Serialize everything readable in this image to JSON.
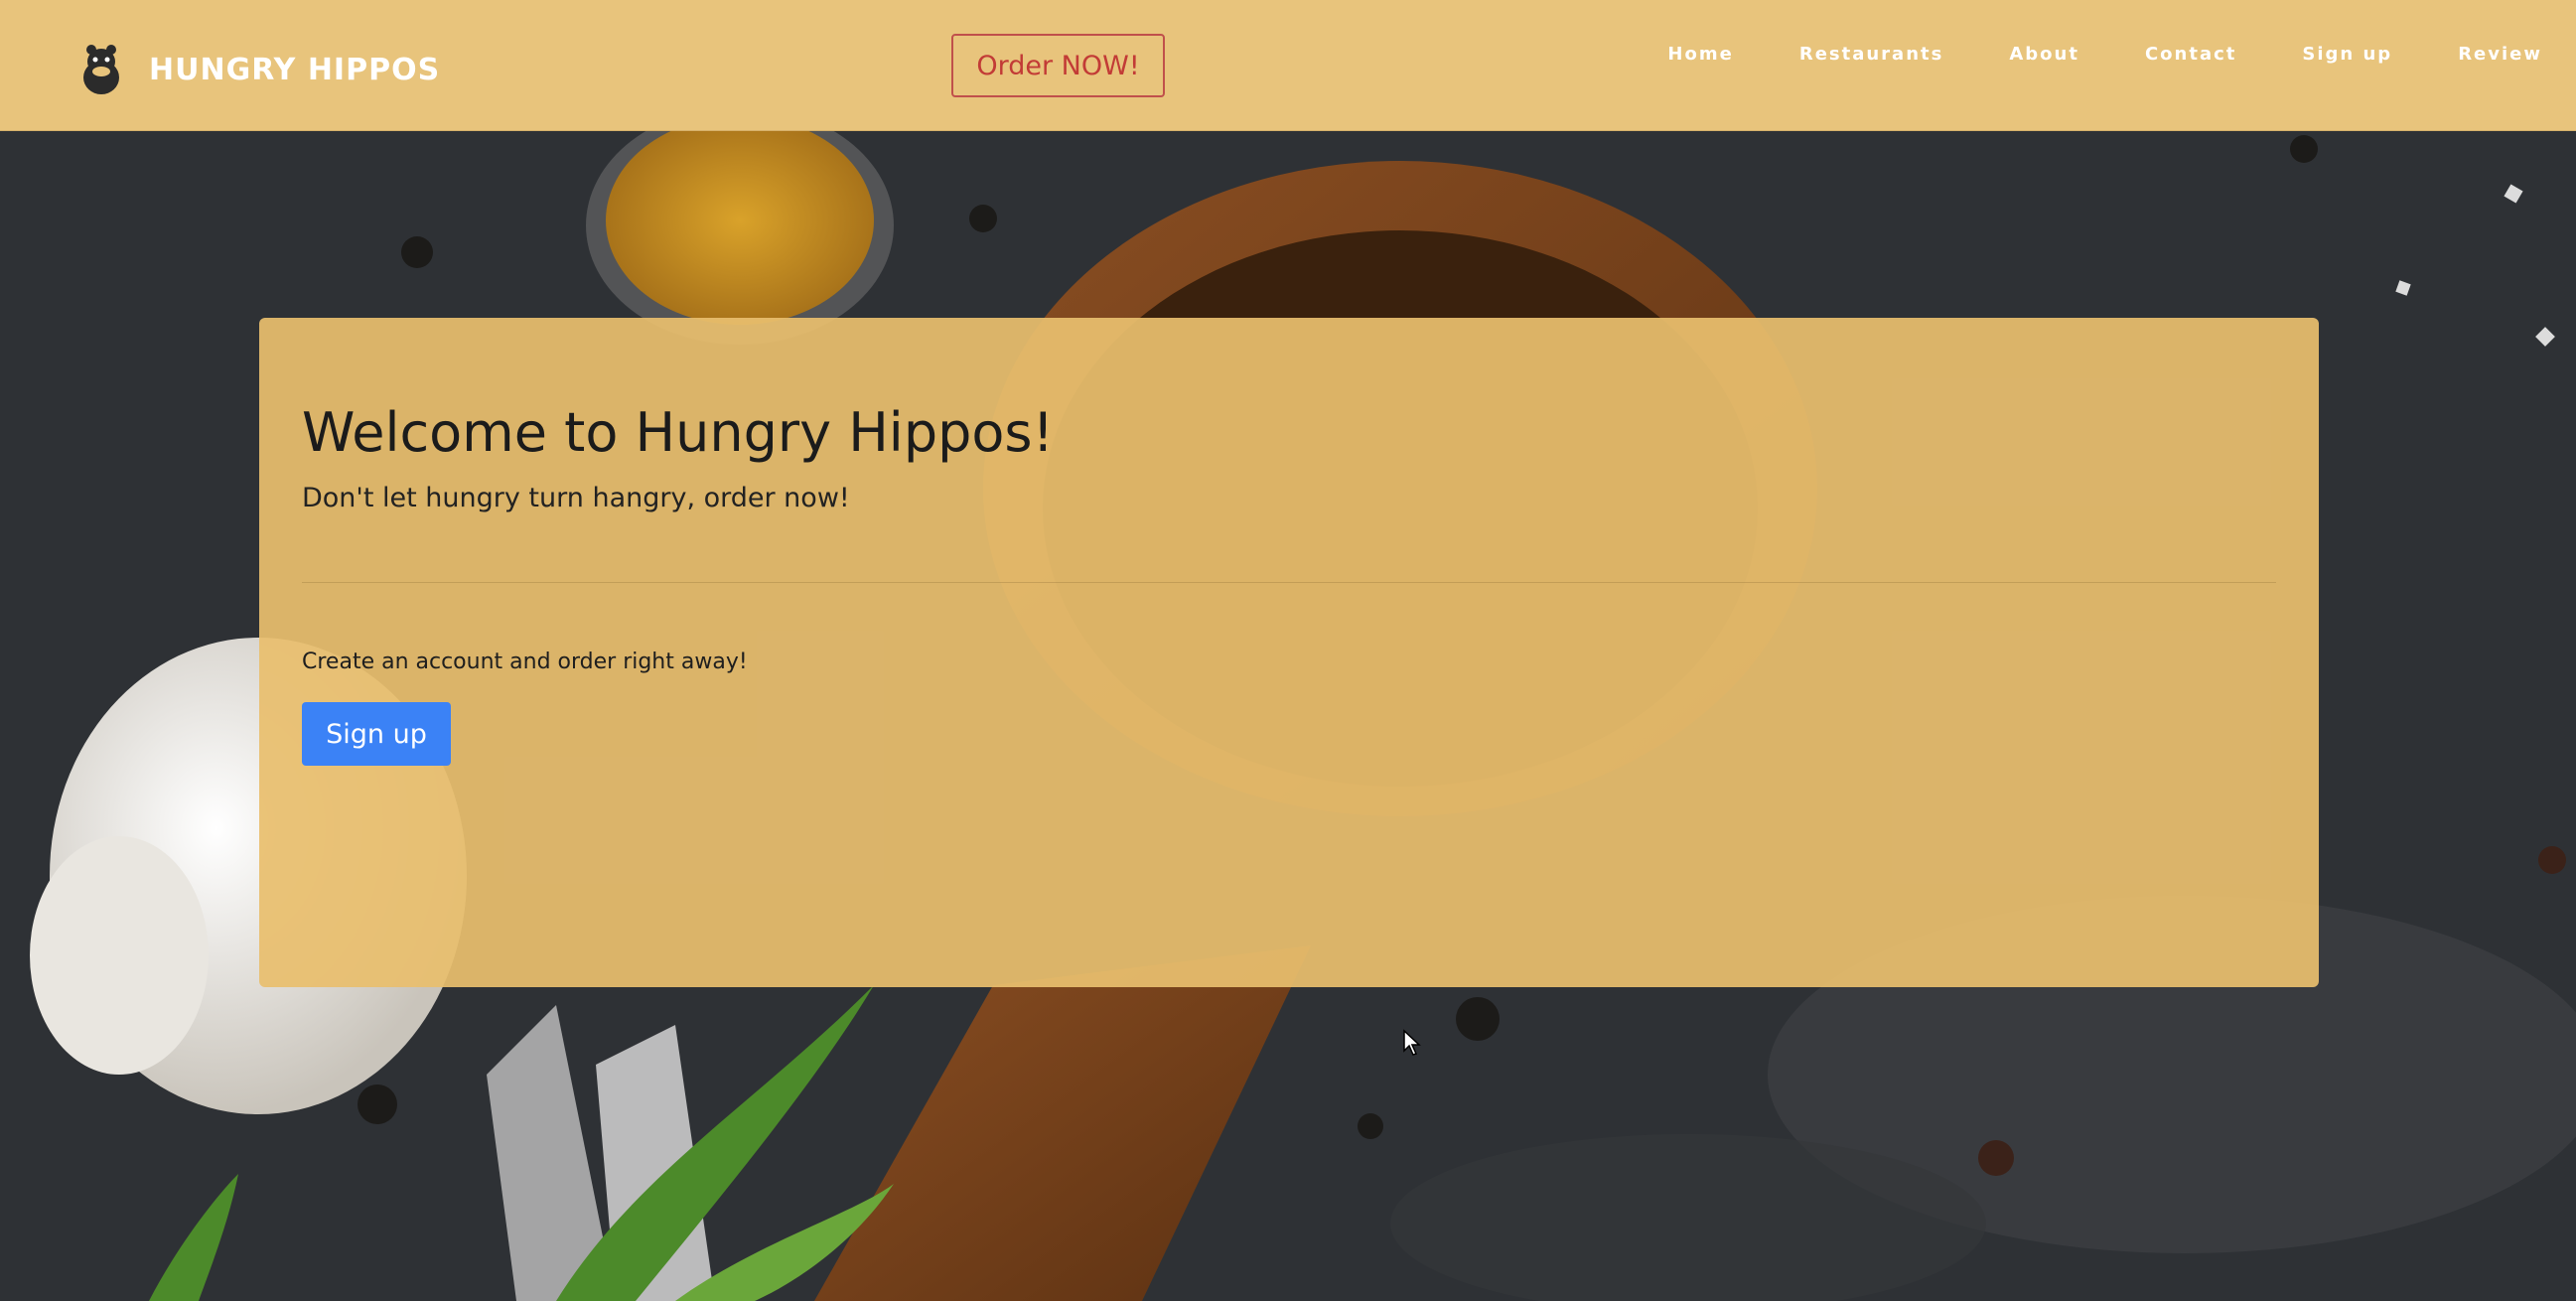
{
  "brand": {
    "name": "HUNGRY HIPPOS",
    "logo_icon": "hippo-logo-icon"
  },
  "header": {
    "order_label": "Order NOW!",
    "nav": [
      {
        "label": "Home"
      },
      {
        "label": "Restaurants"
      },
      {
        "label": "About"
      },
      {
        "label": "Contact"
      },
      {
        "label": "Sign up"
      },
      {
        "label": "Review"
      }
    ]
  },
  "hero": {
    "title": "Welcome to Hungry Hippos!",
    "subtitle": "Don't let hungry turn hangry, order now!",
    "cta_text": "Create an account and order right away!",
    "signup_label": "Sign up"
  },
  "colors": {
    "navbar_bg": "#e8c47c",
    "hero_bg": "#e8be6e",
    "order_accent": "#c23b36",
    "primary_button": "#3b82f6",
    "brand_text": "#ffffff"
  },
  "icons": {
    "cursor": "mouse-pointer-icon"
  }
}
